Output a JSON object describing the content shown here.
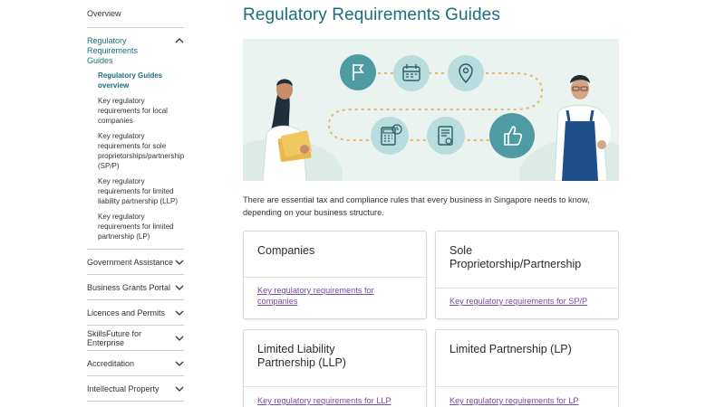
{
  "sidebar": {
    "overview": "Overview",
    "parent": "Regulatory Requirements Guides",
    "subitems": [
      "Regulatory Guides overview",
      "Key regulatory requirements for local companies",
      "Key regulatory requirements for sole proprietorships/partnership (SP/P)",
      "Key regulatory requirements for limited liability partnership (LLP)",
      "Key regulatory requirements for limited partnership (LP)"
    ],
    "sections": [
      "Government Assistance",
      "Business Grants Portal",
      "Licences and Permits",
      "SkillsFuture for Enterprise",
      "Accreditation",
      "Intellectual Property"
    ]
  },
  "main": {
    "title": "Regulatory Requirements Guides",
    "intro": "There are essential tax and compliance rules that every business in Singapore needs to know, depending on your business structure.",
    "cards": [
      {
        "title": "Companies",
        "link": "Key regulatory requirements for companies"
      },
      {
        "title": "Sole Proprietorship/Partnership",
        "link": "Key regulatory requirements for SP/P"
      },
      {
        "title": "Limited Liability Partnership (LLP)",
        "link": "Key regulatory requirements for LLP"
      },
      {
        "title": "Limited Partnership (LP)",
        "link": "Key regulatory requirements for LP"
      }
    ]
  },
  "hero": {
    "icons": [
      "flag-icon",
      "calendar-icon",
      "location-pin-icon",
      "calculator-icon",
      "document-icon",
      "thumbs-up-icon"
    ]
  },
  "colors": {
    "accent": "#1a6f7a",
    "link": "#7a4aa0",
    "hero_bg": "#eaf3ef",
    "icon_circle": "#b9dcdc",
    "icon_circle_dark": "#4f9ba3",
    "dotted_path": "#e9b86a"
  }
}
